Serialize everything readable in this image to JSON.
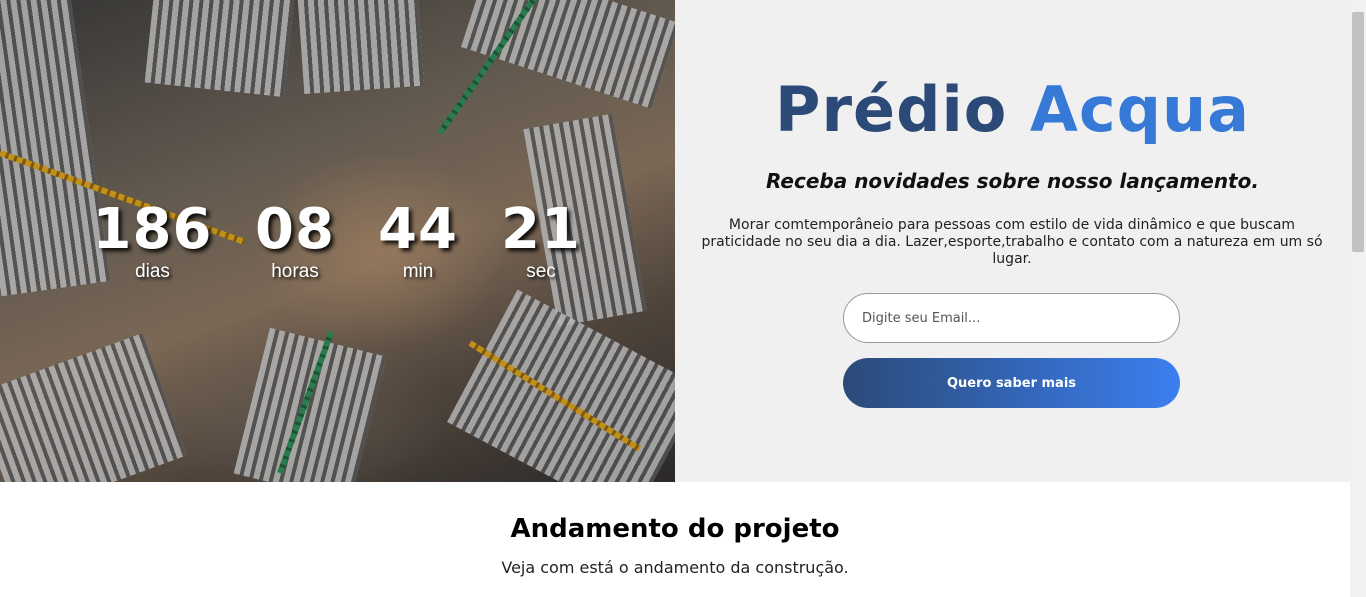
{
  "countdown": {
    "days": {
      "value": "186",
      "label": "dias"
    },
    "hours": {
      "value": "08",
      "label": "horas"
    },
    "minutes": {
      "value": "44",
      "label": "min"
    },
    "seconds": {
      "value": "21",
      "label": "sec"
    }
  },
  "hero": {
    "image_icon": "construction-aerial-photo",
    "title_part1": "Prédio",
    "title_part2": "Acqua",
    "subtitle": "Receba novidades sobre nosso lançamento.",
    "description": "Morar comtemporâneio para pessoas com estilo de vida dinâmico e que buscam praticidade no seu dia a dia. Lazer,esporte,trabalho e contato com a natureza em um só lugar.",
    "email_placeholder": "Digite seu Email...",
    "email_value": "",
    "cta_label": "Quero saber mais"
  },
  "progress": {
    "title": "Andamento do projeto",
    "subtitle": "Veja com está o andamento da construção."
  },
  "colors": {
    "brand_dark": "#2b4a78",
    "brand_light": "#3779d6",
    "panel_bg": "#f0f0f0"
  }
}
